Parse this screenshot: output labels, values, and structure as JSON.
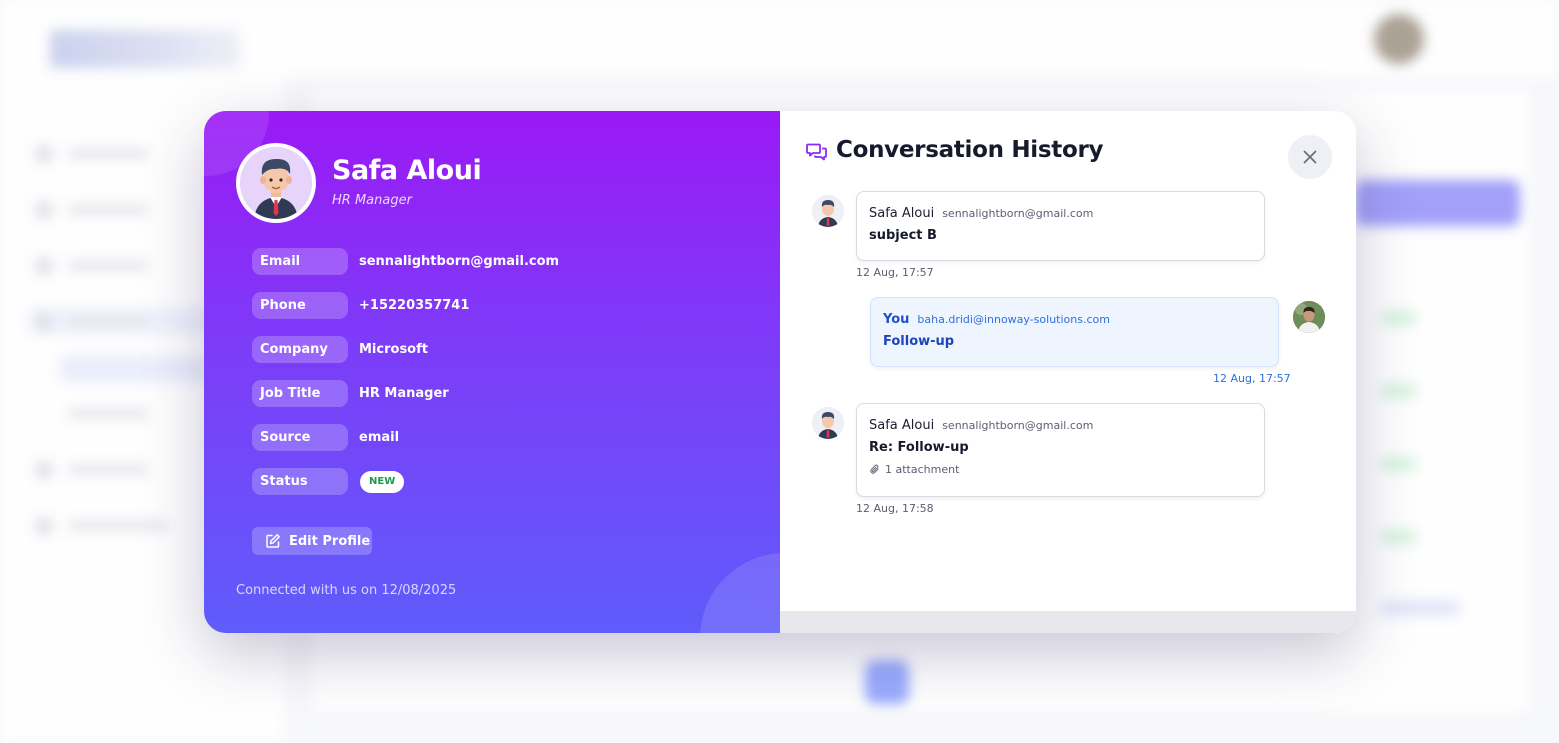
{
  "background_app": {
    "note_visible": false
  },
  "profile": {
    "name": "Safa Aloui",
    "role": "HR Manager",
    "fields": [
      {
        "label": "Email",
        "value": "sennalightborn@gmail.com"
      },
      {
        "label": "Phone",
        "value": "+15220357741"
      },
      {
        "label": "Company",
        "value": "Microsoft"
      },
      {
        "label": "Job Title",
        "value": "HR Manager"
      },
      {
        "label": "Source",
        "value": "email"
      },
      {
        "label": "Status",
        "value": "NEW"
      }
    ],
    "edit_button_label": "Edit Profile",
    "edit_icon": "edit-icon",
    "connected_text": "Connected with us on 12/08/2025"
  },
  "history": {
    "title": "Conversation History",
    "title_icon": "chat-icon",
    "close_icon": "close-icon",
    "messages": [
      {
        "sender": "Safa Aloui",
        "email": "sennalightborn@gmail.com",
        "subject": "subject B",
        "time": "12 Aug, 17:57",
        "own": false
      },
      {
        "sender": "You",
        "email": "baha.dridi@innoway-solutions.com",
        "subject": "Follow-up",
        "time": "12 Aug, 17:57",
        "own": true
      },
      {
        "sender": "Safa Aloui",
        "email": "sennalightborn@gmail.com",
        "subject": "Re: Follow-up",
        "attachment": "1 attachment",
        "time": "12 Aug, 17:58",
        "own": false
      }
    ]
  },
  "colors": {
    "gradient_top": "#9a19f5",
    "gradient_bottom": "#5f5cfb",
    "status_new": "#1a9a4d",
    "own_message_accent": "#2f6fe0"
  }
}
